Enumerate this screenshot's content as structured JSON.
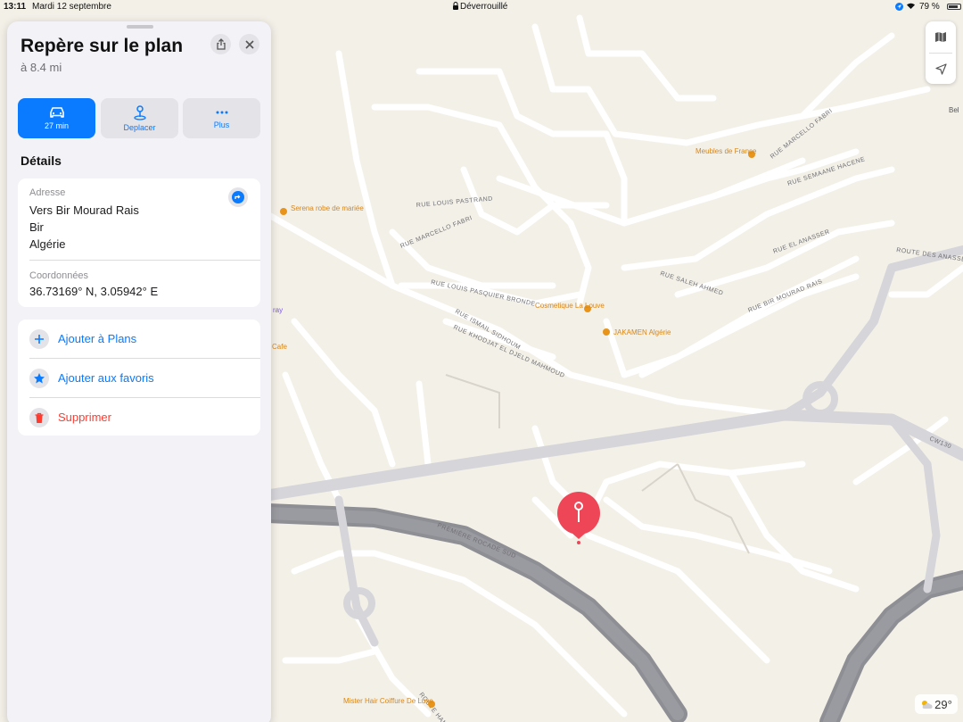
{
  "status_bar": {
    "time": "13:11",
    "date": "Mardi 12 septembre",
    "lock_label": "Déverrouillé",
    "battery": "79 %"
  },
  "panel": {
    "title": "Repère sur le plan",
    "distance": "à 8.4 mi",
    "actions": [
      {
        "label": "27 min",
        "icon": "car-icon"
      },
      {
        "label": "Deplacer",
        "icon": "pin-move-icon"
      },
      {
        "label": "Plus",
        "icon": "ellipsis-icon"
      }
    ],
    "details_heading": "Détails",
    "address_label": "Adresse",
    "address_lines": [
      "Vers Bir Mourad Rais",
      "Bir",
      "Algérie"
    ],
    "coords_label": "Coordonnées",
    "coords_value": "36.73169° N, 3.05942° E",
    "list": [
      {
        "label": "Ajouter à Plans",
        "icon": "plus-icon",
        "color": "#0a7aff"
      },
      {
        "label": "Ajouter aux favoris",
        "icon": "star-icon",
        "color": "#0a7aff"
      },
      {
        "label": "Supprimer",
        "icon": "trash-icon",
        "color": "#ff3b30"
      }
    ]
  },
  "map": {
    "streets": [
      "RUE LOUIS PASTRAND",
      "RUE MARCELLO FABRI",
      "RUE MARCELLO FABRI",
      "RUE LOUIS PASQUIER BRONDE",
      "RUE ISMAIL SIDHOUM",
      "RUE KHODJAT EL DJELD MAHMOUD",
      "PREMIÈRE ROCADE SUD",
      "ROUTE DES ANASSERS",
      "CW130",
      "RUE SEMAANE HACENE",
      "RUE EL ANASSER",
      "RUE SALEH AHMED",
      "RUE BIR MOURAD RAIS",
      "ROUTE HAMMAMET"
    ],
    "pois": [
      "Serena robe de mariée",
      "Meubles de France",
      "Cosmetique La Louve",
      "JAKAMEN Algérie",
      "Mister Hair Coiffure De Luxe"
    ],
    "poi_fragments": [
      "ray",
      "Cafe",
      "Bel"
    ],
    "accent_poi": "#e8941a",
    "pin_color": "#ef4657"
  },
  "weather": {
    "temp": "29°"
  }
}
